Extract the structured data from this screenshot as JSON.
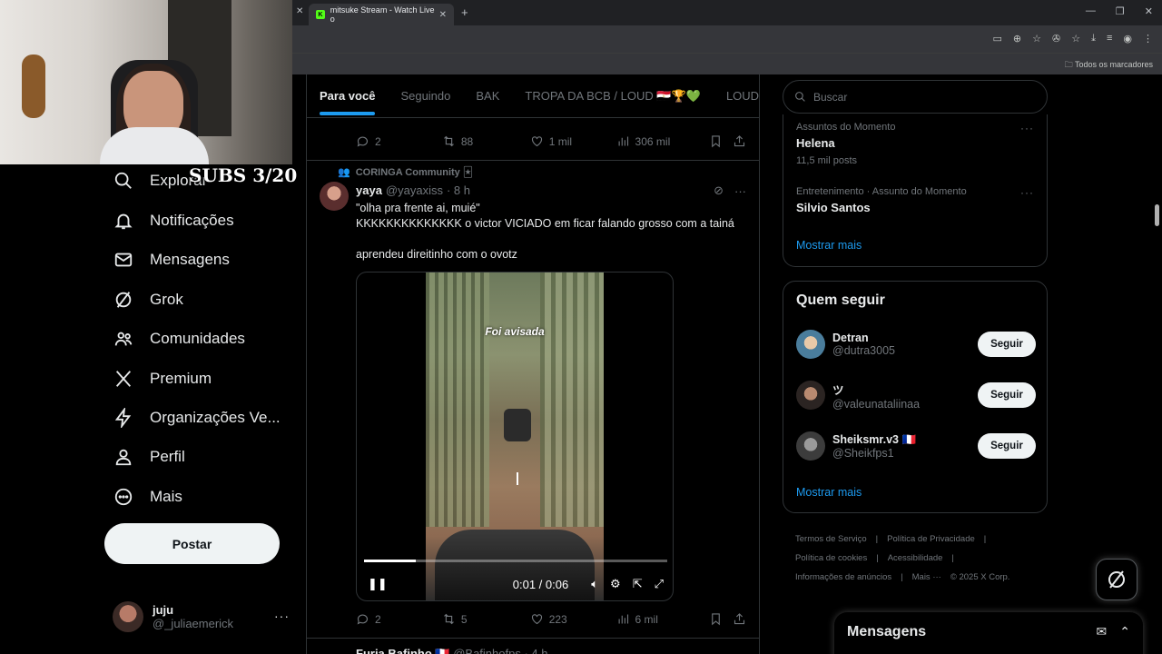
{
  "browser": {
    "tab_title": "mitsuke Stream - Watch Live o",
    "bookmarks_all": "Todos os marcadores"
  },
  "overlay": {
    "subs_label": "SUBS 3/20"
  },
  "nav": {
    "items": [
      {
        "label": "Explorar",
        "icon": "search-icon"
      },
      {
        "label": "Notificações",
        "icon": "bell-icon"
      },
      {
        "label": "Mensagens",
        "icon": "mail-icon"
      },
      {
        "label": "Grok",
        "icon": "grok-icon"
      },
      {
        "label": "Comunidades",
        "icon": "people-icon"
      },
      {
        "label": "Premium",
        "icon": "x-logo-icon"
      },
      {
        "label": "Organizações Ve...",
        "icon": "lightning-icon"
      },
      {
        "label": "Perfil",
        "icon": "person-icon"
      },
      {
        "label": "Mais",
        "icon": "more-circle-icon"
      }
    ],
    "post_button": "Postar",
    "account": {
      "name": "juju",
      "handle": "@_juliaemerick"
    }
  },
  "feed": {
    "tabs": [
      "Para você",
      "Seguindo",
      "BAK",
      "TROPA DA BCB / LOUD 🇪🇬🏆💚",
      "LOUD Co"
    ],
    "prev_post_actions": {
      "replies": "2",
      "reposts": "88",
      "likes": "1 mil",
      "views": "306 mil"
    },
    "post": {
      "community": "CORINGA Community 🃏",
      "name": "yaya",
      "handle": "@yayaxiss",
      "time": "· 8 h",
      "text_line1": "\"olha pra frente ai, muié\"",
      "text_line2": "KKKKKKKKKKKKKK o victor VICIADO em ficar falando grosso com a tainá",
      "text_line3": "aprendeu direitinho com o ovotz",
      "video_overlay": "Foi avisada",
      "video_time": "0:01 / 0:06",
      "video_progress": 0.17,
      "actions": {
        "replies": "2",
        "reposts": "5",
        "likes": "223",
        "views": "6 mil"
      }
    },
    "next_post": {
      "name": "Furia Bafinho 🇫🇷",
      "handle": "@Bafinhofps · 4 h"
    }
  },
  "sidebar": {
    "search_placeholder": "Buscar",
    "trends": [
      {
        "meta": "Assuntos do Momento",
        "title": "Helena",
        "count": "11,5 mil posts"
      },
      {
        "meta": "Entretenimento · Assunto do Momento",
        "title": "Silvio Santos",
        "count": ""
      }
    ],
    "show_more": "Mostrar mais",
    "who_to_follow": {
      "title": "Quem seguir",
      "users": [
        {
          "name": "Detran",
          "handle": "@dutra3005",
          "button": "Seguir"
        },
        {
          "name": "ツ",
          "handle": "@valeunataliinaa",
          "button": "Seguir"
        },
        {
          "name": "Sheiksmr.v3 🇫🇷",
          "handle": "@Sheikfps1",
          "button": "Seguir"
        }
      ],
      "show_more": "Mostrar mais"
    },
    "footer": [
      "Termos de Serviço",
      "|",
      "Política de Privacidade",
      "|",
      "Política de cookies",
      "|",
      "Acessibilidade",
      "|",
      "Informações de anúncios",
      "|",
      "Mais ···",
      "© 2025 X Corp."
    ],
    "messages_drawer": "Mensagens"
  }
}
